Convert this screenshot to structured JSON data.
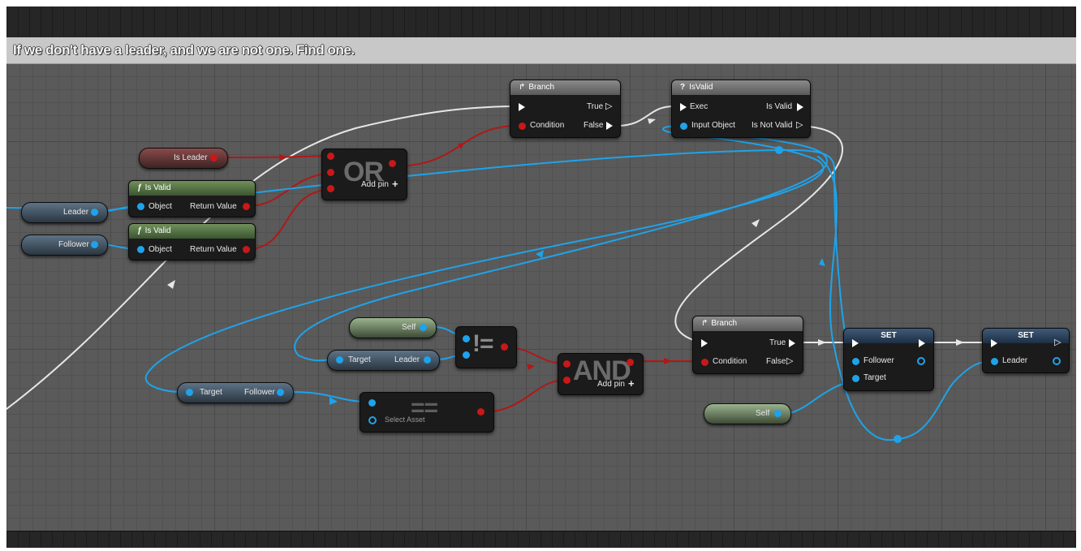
{
  "comment": {
    "text": "If we don't have a leader, and we are not one.  Find one."
  },
  "variables": {
    "is_leader": "Is Leader",
    "leader": "Leader",
    "follower": "Follower",
    "self_top": "Self",
    "self_bottom": "Self"
  },
  "is_valid_fn_1": {
    "title": "Is Valid",
    "object": "Object",
    "return_value": "Return Value"
  },
  "is_valid_fn_2": {
    "title": "Is Valid",
    "object": "Object",
    "return_value": "Return Value"
  },
  "or_node": {
    "symbol": "OR",
    "add_pin": "Add pin"
  },
  "branch_1": {
    "title": "Branch",
    "true": "True",
    "condition": "Condition",
    "false": "False"
  },
  "isvalid_macro": {
    "title": "IsValid",
    "exec": "Exec",
    "is_valid": "Is Valid",
    "input_object": "Input Object",
    "is_not_valid": "Is Not Valid"
  },
  "get_leader": {
    "target": "Target",
    "output": "Leader"
  },
  "get_follower": {
    "target": "Target",
    "output": "Follower"
  },
  "not_equal": {
    "symbol": "!="
  },
  "select_asset": {
    "symbol": "==",
    "label": "Select Asset"
  },
  "and_node": {
    "symbol": "AND",
    "add_pin": "Add pin"
  },
  "branch_2": {
    "title": "Branch",
    "true": "True",
    "condition": "Condition",
    "false": "False"
  },
  "set_1": {
    "title": "SET",
    "follower": "Follower",
    "target": "Target"
  },
  "set_2": {
    "title": "SET",
    "leader": "Leader"
  },
  "colors": {
    "object_pin": "#1ea3ea",
    "bool_pin": "#c81818",
    "exec_wire": "#e6e6e6",
    "comment_bar": "#c8c8c8"
  },
  "icons": [
    "branch-icon",
    "macro-icon",
    "function-icon",
    "plus-icon",
    "exec-pin-icon"
  ]
}
